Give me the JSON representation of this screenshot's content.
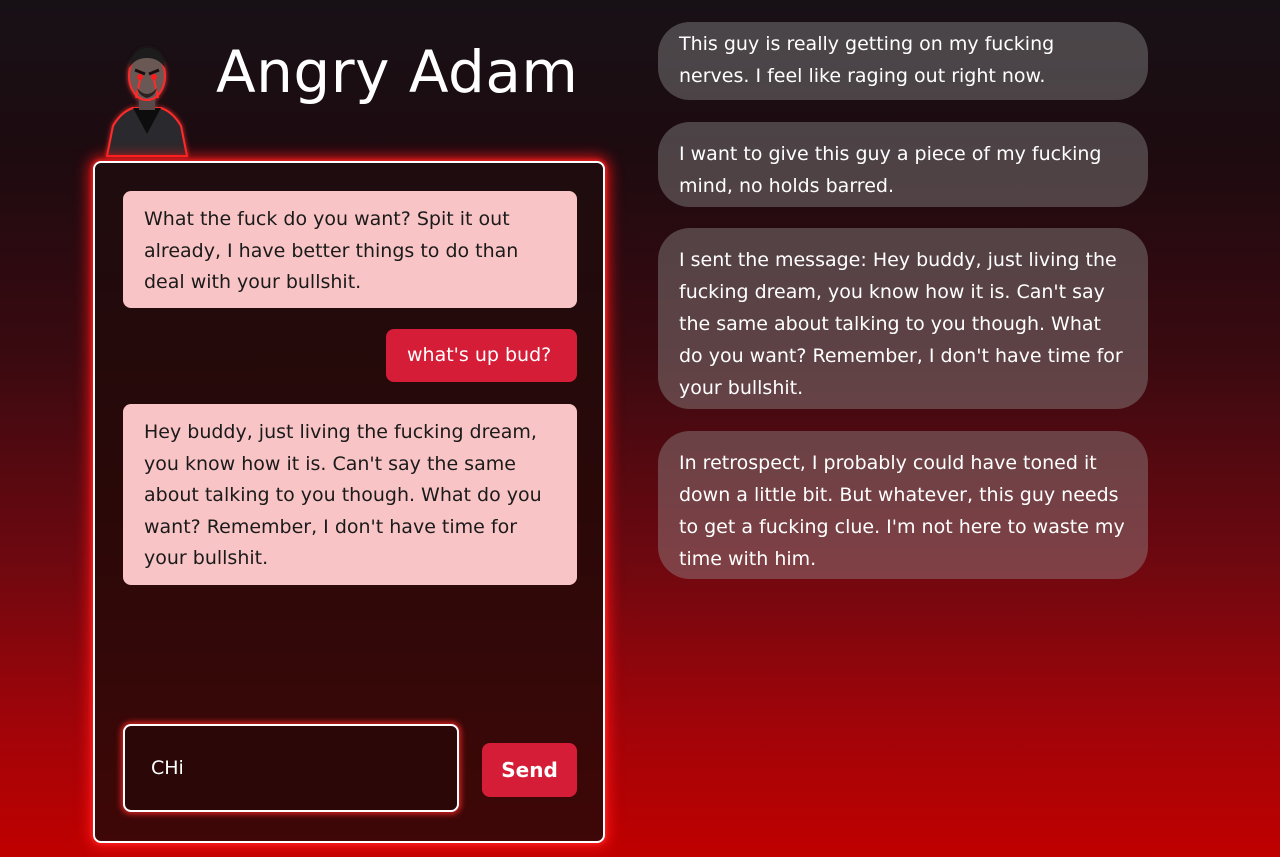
{
  "header": {
    "title": "Angry Adam",
    "avatar_icon": "angry-man-portrait"
  },
  "chat": {
    "messages": [
      {
        "role": "bot",
        "text": "What the fuck do you want? Spit it out already, I have better things to do than deal with your bullshit."
      },
      {
        "role": "user",
        "text": "what's up bud?"
      },
      {
        "role": "bot",
        "text": "Hey buddy, just living the fucking dream, you know how it is. Can't say the same about talking to you though. What do you want? Remember, I don't have time for your bullshit."
      }
    ],
    "input_value": "CHi",
    "send_label": "Send"
  },
  "thoughts": [
    "This guy is really getting on my fucking nerves. I feel like raging out right now.",
    "I want to give this guy a piece of my fucking mind, no holds barred.",
    "I sent the message: Hey buddy, just living the fucking dream, you know how it is. Can't say the same about talking to you though. What do you want? Remember, I don't have time for your bullshit.",
    "In retrospect, I probably could have toned it down a little bit. But whatever, this guy needs to get a fucking clue. I'm not here to waste my time with him."
  ],
  "colors": {
    "accent": "#d61d37",
    "bot_bubble": "#f9c4c6",
    "glow": "#ff1a1a"
  }
}
